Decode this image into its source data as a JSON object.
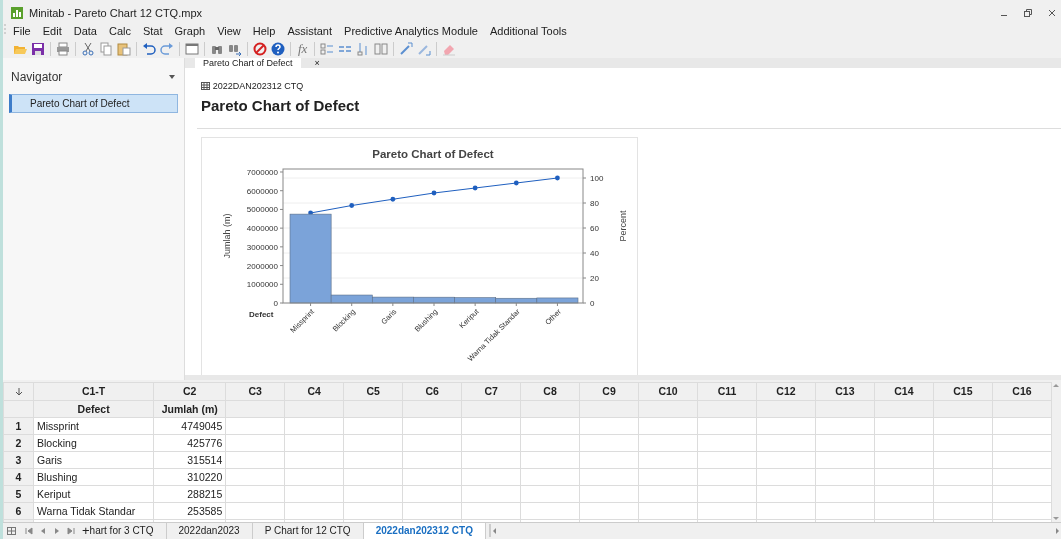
{
  "window": {
    "title": "Minitab - Pareto Chart 12 CTQ.mpx"
  },
  "menu": [
    "File",
    "Edit",
    "Data",
    "Calc",
    "Stat",
    "Graph",
    "View",
    "Help",
    "Assistant",
    "Predictive Analytics Module",
    "Additional Tools"
  ],
  "toolbar": {
    "formula": "fx"
  },
  "navigator": {
    "title": "Navigator",
    "items": [
      {
        "label": "Pareto Chart of Defect",
        "selected": true
      }
    ]
  },
  "output_tab": {
    "label": "Pareto Chart of Defect",
    "close": "×"
  },
  "output": {
    "worksheet": "2022DAN202312 CTQ",
    "heading": "Pareto Chart of Defect",
    "chart_data": {
      "type": "bar",
      "title": "Pareto Chart of Defect",
      "xlabel": "Defect",
      "ylabel": "Jumlah (m)",
      "categories": [
        "Missprint",
        "Blocking",
        "Garis",
        "Blushing",
        "Keriput",
        "Warna Tidak Standar",
        "Other"
      ],
      "series": [
        {
          "color": "#7ba3d9",
          "values": [
            4749045,
            425776,
            315514,
            310220,
            288215,
            253585,
            270000
          ]
        }
      ],
      "ylim": [
        0,
        7160000
      ],
      "yticks": [
        0,
        1000000,
        2000000,
        3000000,
        4000000,
        5000000,
        6000000,
        7000000
      ]
    },
    "cumulative": {
      "chart_data": {
        "type": "line",
        "ylabel": "Percent",
        "series": [
          {
            "color": "#1f5fbf",
            "values": [
              72,
              78,
              83,
              88,
              92,
              96,
              100
            ]
          }
        ],
        "ylim": [
          0,
          107.2
        ],
        "yticks": [
          0,
          20,
          40,
          60,
          80,
          100
        ],
        "grid": true
      }
    }
  },
  "worksheet": {
    "columns": [
      "C1-T",
      "C2",
      "C3",
      "C4",
      "C5",
      "C6",
      "C7",
      "C8",
      "C9",
      "C10",
      "C11",
      "C12",
      "C13",
      "C14",
      "C15",
      "C16"
    ],
    "column_names": [
      "Defect",
      "Jumlah (m)"
    ],
    "rows": [
      {
        "number": "1",
        "cells": [
          "Missprint",
          "4749045"
        ]
      },
      {
        "number": "2",
        "cells": [
          "Blocking",
          "425776"
        ]
      },
      {
        "number": "3",
        "cells": [
          "Garis",
          "315514"
        ]
      },
      {
        "number": "4",
        "cells": [
          "Blushing",
          "310220"
        ]
      },
      {
        "number": "5",
        "cells": [
          "Keriput",
          "288215"
        ]
      },
      {
        "number": "6",
        "cells": [
          "Warna Tidak Standar",
          "253585"
        ]
      }
    ]
  },
  "sheet_bar": {
    "add": "+",
    "tabs": [
      {
        "label": "hart for 3 CTQ",
        "selected": false
      },
      {
        "label": "2022dan2023",
        "selected": false
      },
      {
        "label": "P Chart for 12 CTQ",
        "selected": false
      },
      {
        "label": "2022dan202312 CTQ",
        "selected": true
      }
    ]
  }
}
